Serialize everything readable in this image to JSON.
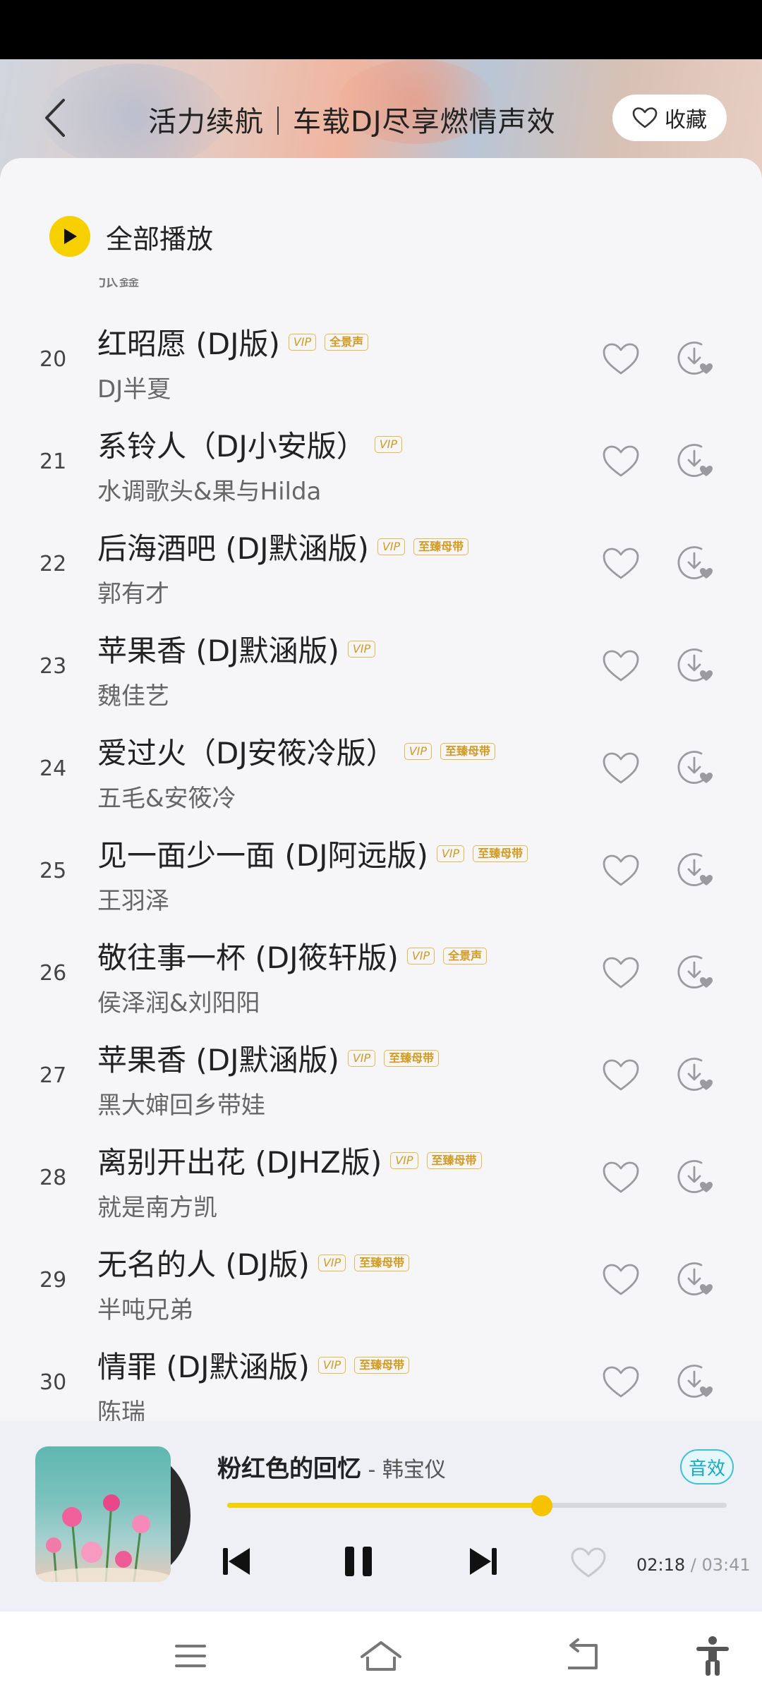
{
  "header": {
    "title": "活力续航｜车载DJ尽享燃情声效",
    "collect_label": "收藏"
  },
  "play_all_label": "全部播放",
  "cut_off_artist": "张鑫",
  "songs": [
    {
      "num": "20",
      "title": "红昭愿 (DJ版)",
      "badges": [
        "VIP",
        "全景声"
      ],
      "artist": "DJ半夏"
    },
    {
      "num": "21",
      "title": "系铃人（DJ小安版）",
      "badges": [
        "VIP"
      ],
      "artist": "水调歌头&果与Hilda"
    },
    {
      "num": "22",
      "title": "后海酒吧 (DJ默涵版)",
      "badges": [
        "VIP",
        "至臻母带"
      ],
      "artist": "郭有才"
    },
    {
      "num": "23",
      "title": "苹果香 (DJ默涵版)",
      "badges": [
        "VIP"
      ],
      "artist": "魏佳艺"
    },
    {
      "num": "24",
      "title": "爱过火（DJ安筱冷版）",
      "badges": [
        "VIP",
        "至臻母带"
      ],
      "artist": "五毛&安筱冷"
    },
    {
      "num": "25",
      "title": "见一面少一面 (DJ阿远版)",
      "badges": [
        "VIP",
        "至臻母带"
      ],
      "artist": "王羽泽"
    },
    {
      "num": "26",
      "title": "敬往事一杯 (DJ筱轩版)",
      "badges": [
        "VIP",
        "全景声"
      ],
      "artist": "侯泽润&刘阳阳"
    },
    {
      "num": "27",
      "title": "苹果香 (DJ默涵版)",
      "badges": [
        "VIP",
        "至臻母带"
      ],
      "artist": "黑大婶回乡带娃"
    },
    {
      "num": "28",
      "title": "离别开出花 (DJHZ版)",
      "badges": [
        "VIP",
        "至臻母带"
      ],
      "artist": "就是南方凯"
    },
    {
      "num": "29",
      "title": "无名的人 (DJ版)",
      "badges": [
        "VIP",
        "至臻母带"
      ],
      "artist": "半吨兄弟"
    },
    {
      "num": "30",
      "title": "情罪 (DJ默涵版)",
      "badges": [
        "VIP",
        "至臻母带"
      ],
      "artist": "陈瑞"
    }
  ],
  "player": {
    "title": "粉红色的回忆",
    "separator": " - ",
    "artist": "韩宝仪",
    "effect_label": "音效",
    "progress": 0.63,
    "current_time": "02:18",
    "time_separator": " / ",
    "total_time": "03:41"
  },
  "colors": {
    "accent": "#f7d000",
    "badge": "#e9b84a",
    "effect": "#19a9c4"
  }
}
